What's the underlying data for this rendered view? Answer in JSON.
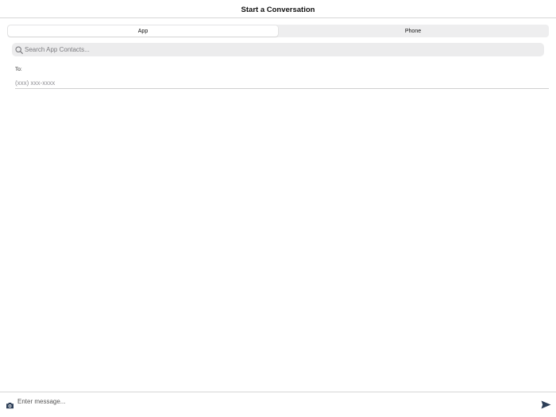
{
  "header": {
    "title": "Start a Conversation"
  },
  "segmented": {
    "tabs": [
      {
        "label": "App",
        "selected": true
      },
      {
        "label": "Phone",
        "selected": false
      }
    ]
  },
  "search": {
    "placeholder": "Search App Contacts...",
    "value": "",
    "icon": "search-icon"
  },
  "recipient": {
    "label": "To:",
    "placeholder": "(xxx) xxx-xxxx",
    "value": ""
  },
  "composer": {
    "placeholder": "Enter message...",
    "value": "",
    "camera_icon": "camera-icon",
    "send_icon": "send-icon"
  },
  "colors": {
    "accent": "#2c3e57",
    "segment_bg": "#eeeeef",
    "search_bg": "#ececed",
    "divider": "#d6d6d6"
  }
}
